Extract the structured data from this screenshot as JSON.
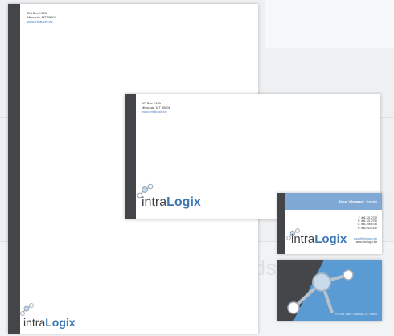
{
  "brand": {
    "logo_plain": "intra",
    "logo_bold": "Logix",
    "color_dark": "#444548",
    "color_blue": "#3b78b5",
    "color_card_blue": "#7fa9d4"
  },
  "address": {
    "line1": "PO Box 1389",
    "line2": "Missoula, MT 59806",
    "web": "www.intralogix.biz"
  },
  "business_card": {
    "name": "Doug Vikegaard",
    "title": "President",
    "phone_t": "T: 406.721.0722",
    "phone_f": "F: 406.721.0796",
    "phone_c": "C: 406.396.8756",
    "phone_h": "H: 406.543.7532",
    "email": "doug@intralogix.biz",
    "web": "www.intralogix.biz",
    "back_address": "PO Box 1389 · Missoula, MT 59806"
  }
}
